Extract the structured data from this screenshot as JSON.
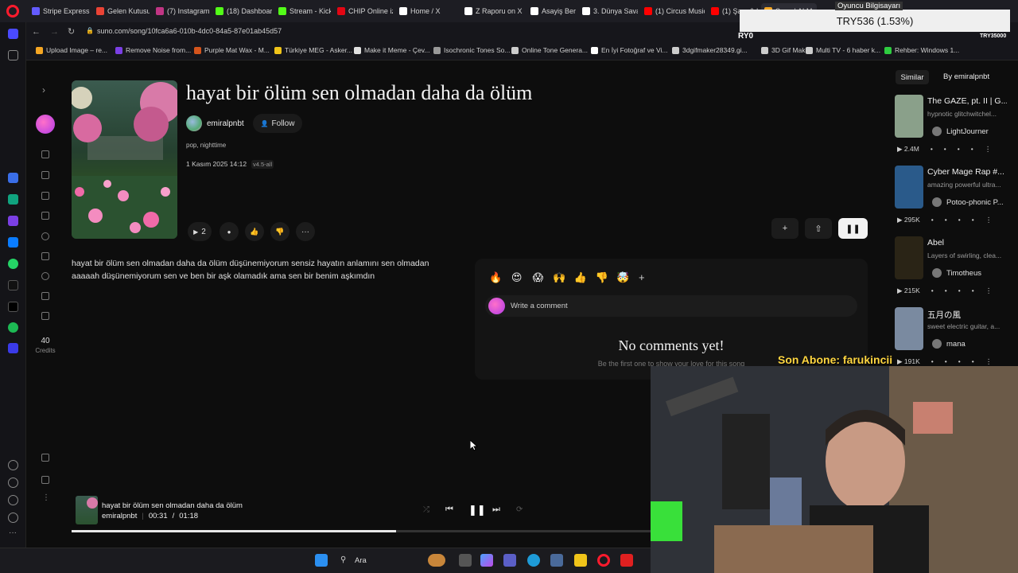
{
  "browser": {
    "tabs": [
      {
        "label": "Stripe Express",
        "color": "#635bff"
      },
      {
        "label": "Gelen Kutusu (",
        "color": "#ea4335"
      },
      {
        "label": "(7) Instagram",
        "color": "#c13584"
      },
      {
        "label": "(18) Dashboard",
        "color": "#53fc18"
      },
      {
        "label": "Stream - Kick D",
        "color": "#53fc18"
      },
      {
        "label": "CHIP Online iz",
        "color": "#e30613"
      },
      {
        "label": "Home / X",
        "color": "#ffffff"
      },
      {
        "label": "Z Raporu on X",
        "color": "#ffffff"
      },
      {
        "label": "Asayiş Berkem",
        "color": "#ffffff"
      },
      {
        "label": "3. Dünya Savaş",
        "color": "#ffffff"
      },
      {
        "label": "(1) Circus Music",
        "color": "#ff0000"
      },
      {
        "label": "(1) Şam & Laci",
        "color": "#ff0000"
      },
      {
        "label": "Suno | AI Music",
        "color": "#f5a623"
      }
    ],
    "url": "suno.com/song/10fca6a6-010b-4dc0-84a5-87e01ab45d57",
    "bookmarks": [
      {
        "label": "Upload Image – re...",
        "color": "#f5a623"
      },
      {
        "label": "Remove Noise from...",
        "color": "#7b3fe4"
      },
      {
        "label": "Purple Mat Wax - M...",
        "color": "#d4541c"
      },
      {
        "label": "Türkiye MEG - Asker...",
        "color": "#f0c419"
      },
      {
        "label": "Make it Meme - Çev...",
        "color": "#e0e0e0"
      },
      {
        "label": "Isochronic Tones So...",
        "color": "#999999"
      },
      {
        "label": "Online Tone Genera...",
        "color": "#cccccc"
      },
      {
        "label": "En İyi Fotoğraf ve Vi...",
        "color": "#ffffff"
      },
      {
        "label": "3dgifmaker28349.gi...",
        "color": "#cccccc"
      },
      {
        "label": "3D Gif Maker",
        "color": "#cccccc"
      },
      {
        "label": "Multi TV - 6 haber k...",
        "color": "#cccccc"
      },
      {
        "label": "Rehber: Windows 1...",
        "color": "#2ecc40"
      }
    ]
  },
  "overlay": {
    "ticker": "TRY536 (1.53%)",
    "ticker_top": "Oyuncu Bilgisayarı",
    "ticker_left": "RY0",
    "ticker_right": "TRY35000",
    "subscriber": "Son Abone: farukincii"
  },
  "suno_sidebar": {
    "credits_value": "40",
    "credits_label": "Credits"
  },
  "song": {
    "title": "hayat bir ölüm sen olmadan daha da ölüm",
    "author": "emiralpnbt",
    "follow_label": "Follow",
    "tags": "pop, nighttime",
    "date": "1 Kasım 2025 14:12",
    "version": "v4.5-all",
    "play_count": "2",
    "lyrics": [
      "hayat bir ölüm sen olmadan daha da ölüm düşünemiyorum sensiz hayatın anlamını sen olmadan",
      "aaaaah düşünemiyorum sen ve ben bir aşk olamadık ama sen bir benim aşkımdın"
    ]
  },
  "comments": {
    "emojis": [
      "🔥",
      "😍",
      "😱",
      "🙌",
      "👍",
      "👎",
      "🤯"
    ],
    "placeholder": "Write a comment",
    "empty_title": "No comments yet!",
    "empty_sub": "Be the first one to show your love for this song"
  },
  "right_panel": {
    "tab_similar": "Similar",
    "tab_by": "By emiralpnbt",
    "items": [
      {
        "title": "The GAZE, pt. II | G...",
        "desc": "hypnotic glitchwitchel...",
        "author": "LightJourner",
        "plays": "2.4M",
        "thumb": "#8aa08a"
      },
      {
        "title": "Cyber Mage Rap #...",
        "desc": "amazing powerful ultra...",
        "author": "Potoo-phonic P...",
        "plays": "295K",
        "thumb": "#2a5a8a"
      },
      {
        "title": "Abel",
        "desc": "Layers of swirling, clea...",
        "author": "Timotheus",
        "plays": "215K",
        "thumb": "#2a2416"
      },
      {
        "title": "五月の風",
        "desc": "sweet electric guitar, a...",
        "author": "mana",
        "plays": "191K",
        "thumb": "#7a8aa0"
      }
    ]
  },
  "player": {
    "title": "hayat bir ölüm sen olmadan daha da ölüm",
    "artist": "emiralpnbt",
    "time_current": "00:31",
    "time_sep": "/",
    "time_total": "01:18",
    "progress": 0.56
  },
  "taskbar": {
    "search_label": "Ara"
  }
}
